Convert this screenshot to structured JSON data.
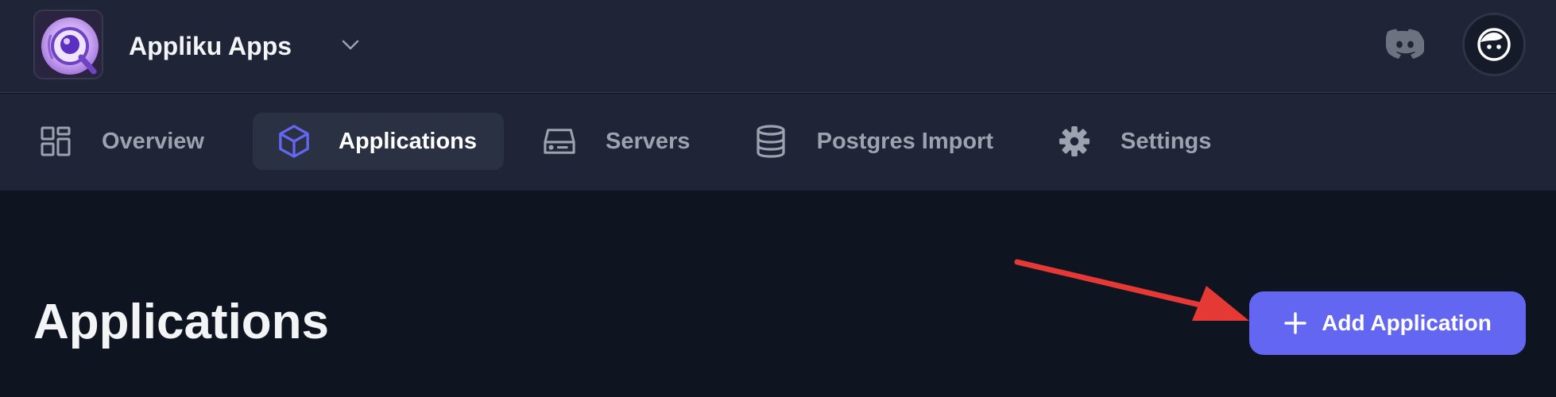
{
  "header": {
    "team_name": "Appliku Apps",
    "logo_icon": "appliku-logo-icon",
    "chevron_icon": "chevron-down-icon",
    "discord_icon": "discord-icon",
    "avatar_icon": "user-avatar-icon"
  },
  "nav": {
    "items": [
      {
        "label": "Overview",
        "icon": "grid-icon",
        "active": false
      },
      {
        "label": "Applications",
        "icon": "cube-icon",
        "active": true
      },
      {
        "label": "Servers",
        "icon": "server-icon",
        "active": false
      },
      {
        "label": "Postgres Import",
        "icon": "database-icon",
        "active": false
      },
      {
        "label": "Settings",
        "icon": "gear-icon",
        "active": false
      }
    ]
  },
  "main": {
    "title": "Applications",
    "add_button_label": "Add Application",
    "add_button_icon": "plus-icon"
  },
  "annotation": {
    "arrow_icon": "red-arrow-icon"
  },
  "colors": {
    "header_bg": "#1f2537",
    "page_bg": "#0f1421",
    "accent": "#6366f1",
    "annotation_arrow": "#e53935"
  }
}
